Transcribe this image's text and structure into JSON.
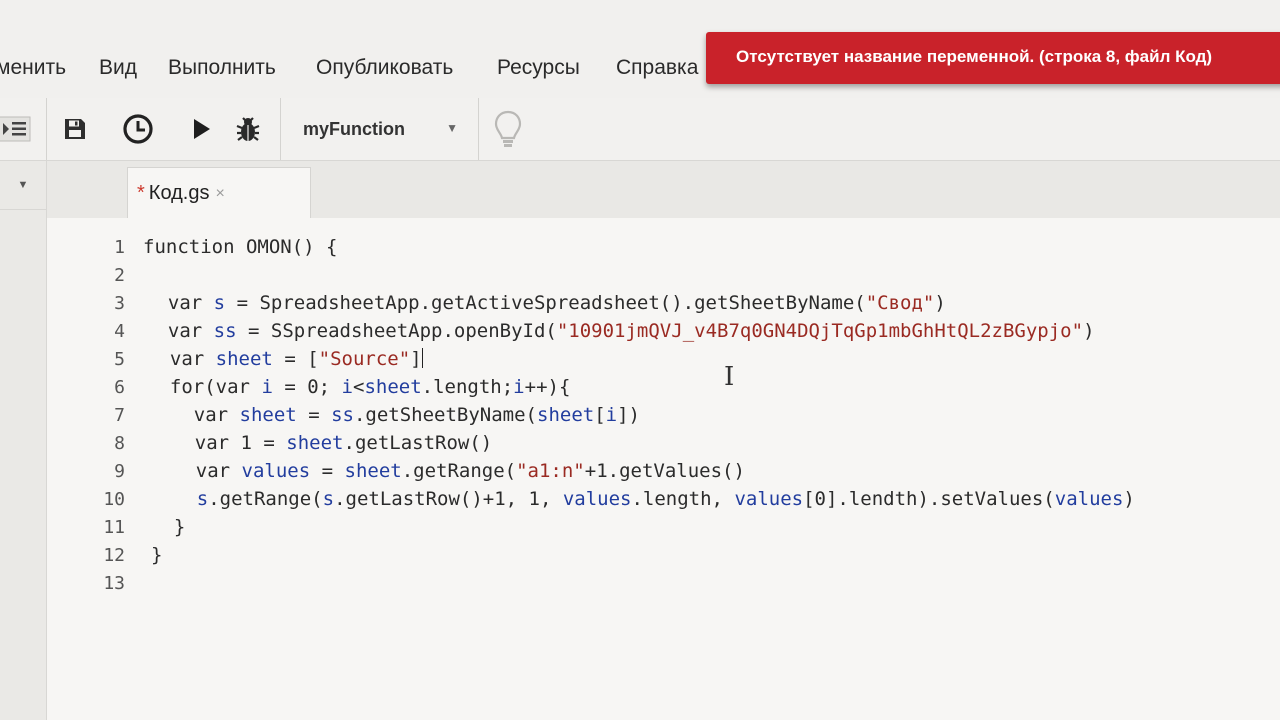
{
  "menu": {
    "items": [
      "менить",
      "Вид",
      "Выполнить",
      "Опубликовать",
      "Ресурсы",
      "Справка"
    ]
  },
  "toast": {
    "message": "Отсутствует название переменной. (строка 8, файл Код)",
    "color": "#c9222a"
  },
  "toolbar": {
    "function_selector": "myFunction",
    "icons": [
      "indent-icon",
      "save-icon",
      "triggers-clock-icon",
      "run-icon",
      "debug-bug-icon",
      "lightbulb-icon"
    ]
  },
  "tab": {
    "unsaved_marker": "*",
    "file_name": "Код.gs",
    "close_glyph": "×"
  },
  "editor": {
    "line_numbers": [
      "1",
      "2",
      "3",
      "4",
      "5",
      "6",
      "7",
      "8",
      "9",
      "10",
      "11",
      "12",
      "13"
    ],
    "lines": [
      "function OMON() {",
      "",
      "  var s = SpreadsheetApp.getActiveSpreadsheet().getSheetByName(\"Свод\")",
      "  var ss = SSpreadsheetApp.openById(\"10901jmQVJ_v4B7q0GN4DQjTqGp1mbGhHtQL2zBGypjo\")",
      "  var sheet = [\"Source\"]",
      "  for(var i = 0; i<sheet.length;i++){",
      "    var sheet = ss.getSheetByName(sheet[i])",
      "    var 1 = sheet.getLastRow()",
      "    var values = sheet.getRange(\"a1:n\"+1.getValues()",
      "    s.getRange(s.getLastRow()+1, 1, values.length, values[0].lendth).setValues(values)",
      "  }",
      "}",
      ""
    ]
  }
}
